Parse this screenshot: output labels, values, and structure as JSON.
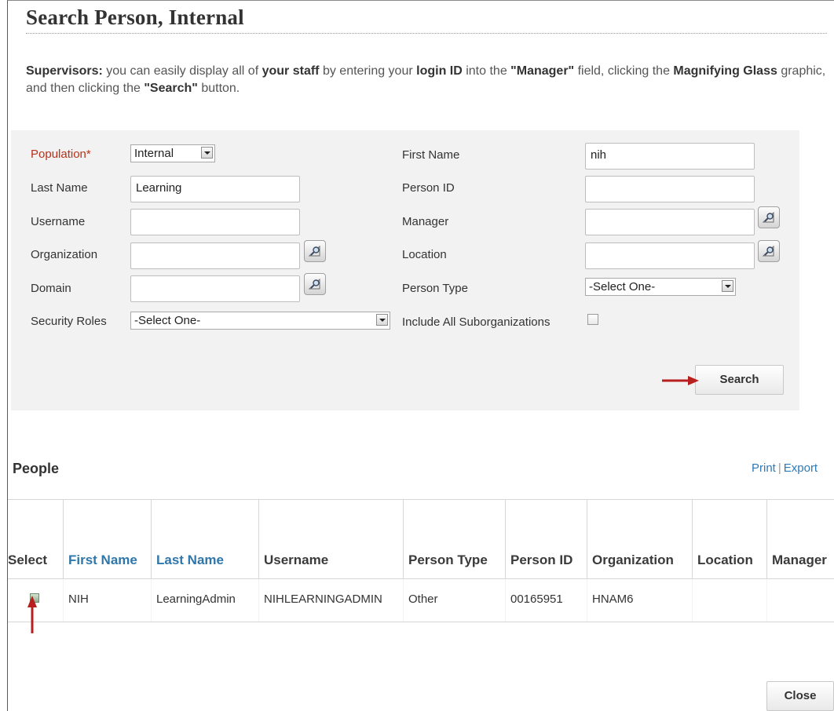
{
  "page": {
    "title": "Search Person, Internal",
    "intro": {
      "p1": "Supervisors:",
      "p2": " you can easily display all of ",
      "p3": "your staff",
      "p4": " by entering your ",
      "p5": "login ID",
      "p6": " into the ",
      "p7": "\"Manager\"",
      "p8": " field, clicking the ",
      "p9": "Magnifying Glass",
      "p10": " graphic, and then clicking the ",
      "p11": "\"Search\"",
      "p12": " button."
    }
  },
  "form": {
    "population": {
      "label": "Population*",
      "value": "Internal"
    },
    "last_name": {
      "label": "Last Name",
      "value": "Learning"
    },
    "username": {
      "label": "Username",
      "value": ""
    },
    "organization": {
      "label": "Organization",
      "value": ""
    },
    "domain": {
      "label": "Domain",
      "value": ""
    },
    "security_roles": {
      "label": "Security Roles",
      "value": "-Select One-"
    },
    "first_name": {
      "label": "First Name",
      "value": "nih"
    },
    "person_id": {
      "label": "Person ID",
      "value": ""
    },
    "manager": {
      "label": "Manager",
      "value": ""
    },
    "location": {
      "label": "Location",
      "value": ""
    },
    "person_type": {
      "label": "Person Type",
      "value": "-Select One-"
    },
    "include_suborgs": {
      "label": "Include All Suborganizations",
      "checked": false
    },
    "search_label": "Search"
  },
  "results": {
    "title": "People",
    "print_label": "Print",
    "export_label": "Export",
    "columns": [
      "Select",
      "First Name",
      "Last Name",
      "Username",
      "Person Type",
      "Person ID",
      "Organization",
      "Location",
      "Manager"
    ],
    "rows": [
      {
        "first_name": "NIH",
        "last_name": "LearningAdmin",
        "username": "NIHLEARNINGADMIN",
        "person_type": "Other",
        "person_id": "00165951",
        "organization": "HNAM6",
        "location": "",
        "manager": ""
      }
    ]
  },
  "footer": {
    "close_label": "Close"
  },
  "colors": {
    "required_label": "#b8321a",
    "link": "#2f76a9",
    "annotation_arrow": "#b81f1f",
    "panel_bg": "#f2f2f2"
  }
}
